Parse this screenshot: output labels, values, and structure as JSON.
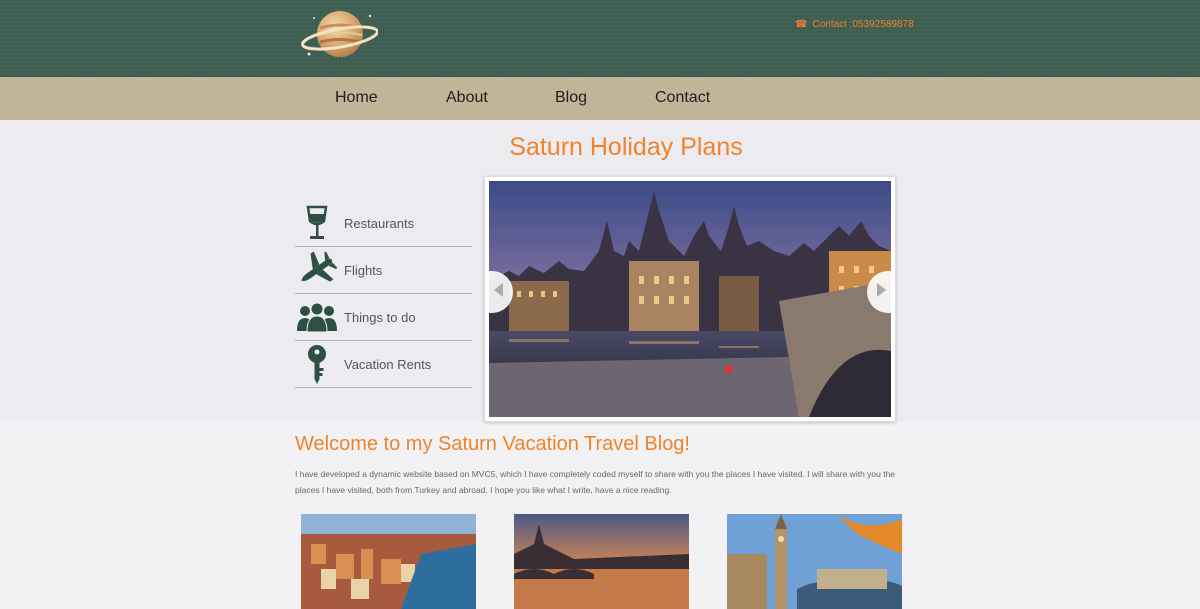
{
  "header": {
    "logo_icon": "saturn-planet-logo",
    "contact_icon": "phone-icon",
    "contact_text": "Contact :05392589878",
    "accent": "#f0832a",
    "bg": "#3f5e52"
  },
  "nav": {
    "items": [
      {
        "label": "Home"
      },
      {
        "label": "About"
      },
      {
        "label": "Blog"
      },
      {
        "label": "Contact"
      }
    ],
    "bg": "#c0b396"
  },
  "hero": {
    "title": "Saturn Holiday Plans",
    "sidebar": [
      {
        "label": "Restaurants",
        "icon": "wine-glass-icon"
      },
      {
        "label": "Flights",
        "icon": "airplane-icon"
      },
      {
        "label": "Things to do",
        "icon": "people-icon"
      },
      {
        "label": "Vacation Rents",
        "icon": "key-icon"
      }
    ],
    "slider": {
      "prev_icon": "chevron-left-icon",
      "next_icon": "chevron-right-icon"
    }
  },
  "welcome": {
    "title": "Welcome to my Saturn Vacation Travel Blog!",
    "text": "I have developed a dynamic website based on MVC5, which I have completely coded myself to share with you the places I have visited. I will share with you the places I have visited, both from Turkey and abroad. I hope you like what I write, have a nice reading."
  },
  "thumbnails": [
    {
      "icon": "colorful-harbor-city-photo"
    },
    {
      "icon": "river-bridge-sunset-photo"
    },
    {
      "icon": "big-ben-autumn-photo"
    }
  ]
}
